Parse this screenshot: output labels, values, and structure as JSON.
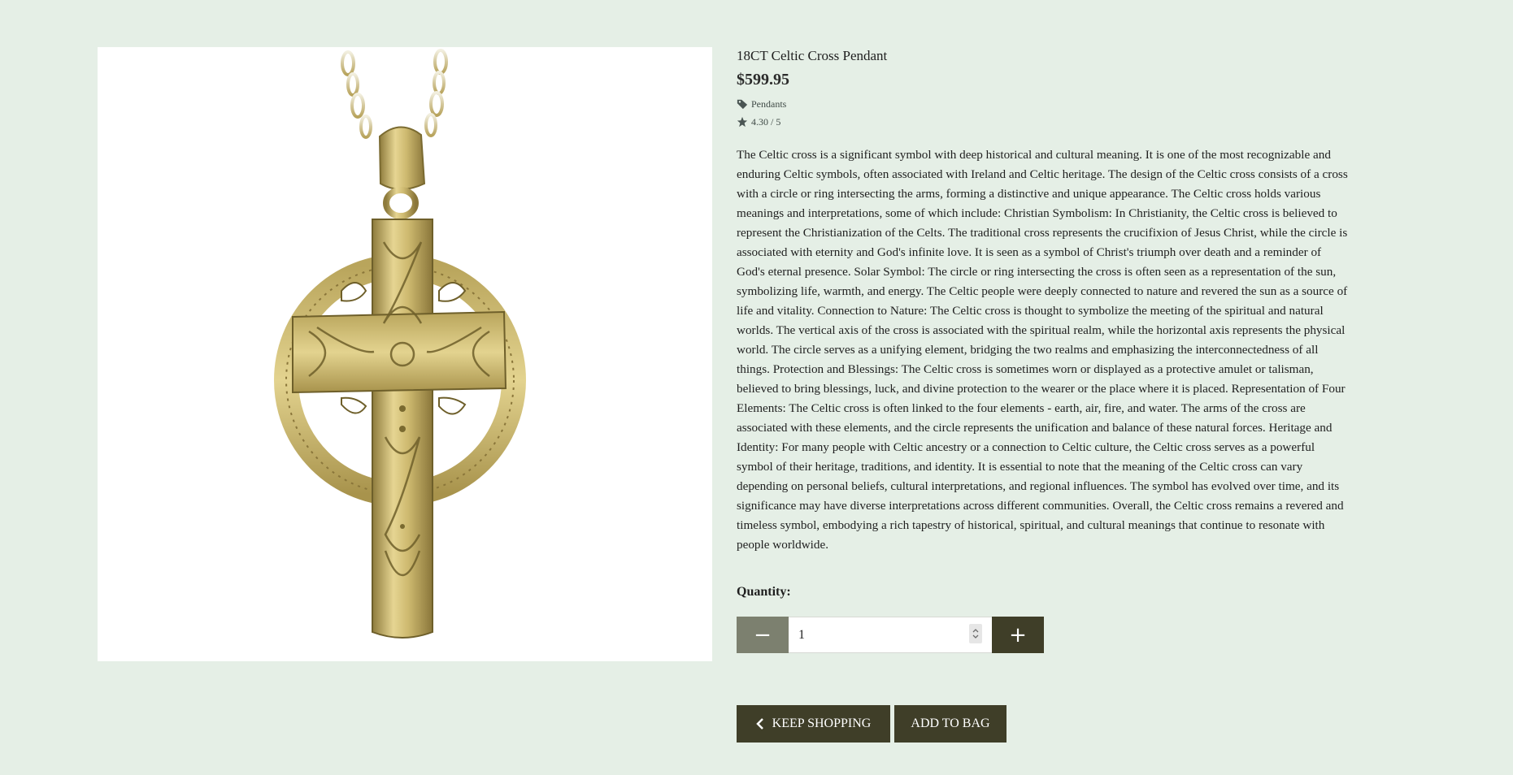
{
  "product": {
    "title": "18CT Celtic Cross Pendant",
    "price": "$599.95",
    "category": "Pendants",
    "rating": "4.30 / 5",
    "description": "The Celtic cross is a significant symbol with deep historical and cultural meaning. It is one of the most recognizable and enduring Celtic symbols, often associated with Ireland and Celtic heritage. The design of the Celtic cross consists of a cross with a circle or ring intersecting the arms, forming a distinctive and unique appearance. The Celtic cross holds various meanings and interpretations, some of which include: Christian Symbolism: In Christianity, the Celtic cross is believed to represent the Christianization of the Celts. The traditional cross represents the crucifixion of Jesus Christ, while the circle is associated with eternity and God's infinite love. It is seen as a symbol of Christ's triumph over death and a reminder of God's eternal presence. Solar Symbol: The circle or ring intersecting the cross is often seen as a representation of the sun, symbolizing life, warmth, and energy. The Celtic people were deeply connected to nature and revered the sun as a source of life and vitality. Connection to Nature: The Celtic cross is thought to symbolize the meeting of the spiritual and natural worlds. The vertical axis of the cross is associated with the spiritual realm, while the horizontal axis represents the physical world. The circle serves as a unifying element, bridging the two realms and emphasizing the interconnectedness of all things. Protection and Blessings: The Celtic cross is sometimes worn or displayed as a protective amulet or talisman, believed to bring blessings, luck, and divine protection to the wearer or the place where it is placed. Representation of Four Elements: The Celtic cross is often linked to the four elements - earth, air, fire, and water. The arms of the cross are associated with these elements, and the circle represents the unification and balance of these natural forces. Heritage and Identity: For many people with Celtic ancestry or a connection to Celtic culture, the Celtic cross serves as a powerful symbol of their heritage, traditions, and identity. It is essential to note that the meaning of the Celtic cross can vary depending on personal beliefs, cultural interpretations, and regional influences. The symbol has evolved over time, and its significance may have diverse interpretations across different communities. Overall, the Celtic cross remains a revered and timeless symbol, embodying a rich tapestry of historical, spiritual, and cultural meanings that continue to resonate with people worldwide."
  },
  "quantity": {
    "label": "Quantity:",
    "value": "1",
    "decrement_label": "−",
    "increment_label": "+"
  },
  "actions": {
    "keep_shopping_label": "KEEP SHOPPING",
    "add_to_bag_label": "ADD TO BAG"
  },
  "icons": {
    "category": "tag-icon",
    "rating": "star-icon",
    "keep_shopping": "chevron-left-icon"
  },
  "colors": {
    "page_background": "#e5efe6",
    "button_dark": "#3f3e28",
    "button_muted": "#7c806f",
    "gold": "#c9b56a"
  }
}
